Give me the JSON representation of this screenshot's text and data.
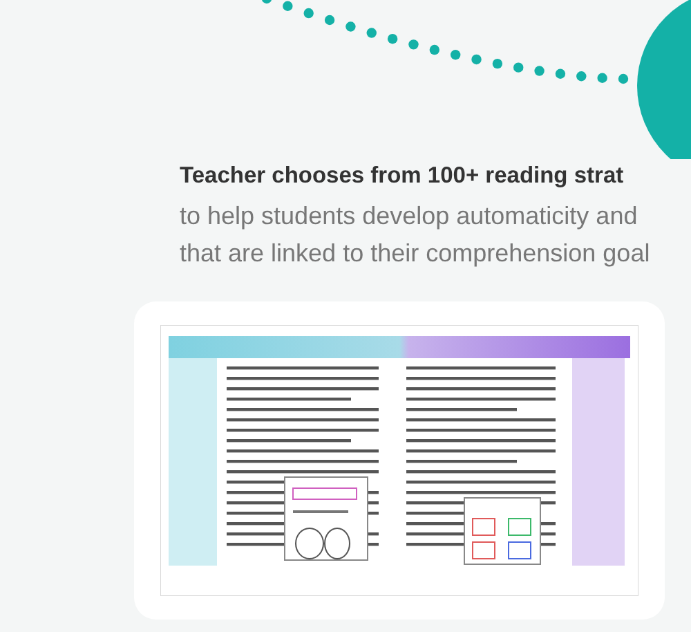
{
  "heading": "Teacher chooses from 100+ reading strat",
  "description_lines": [
    "to help students develop automaticity and",
    "that are linked to their comprehension goal"
  ]
}
